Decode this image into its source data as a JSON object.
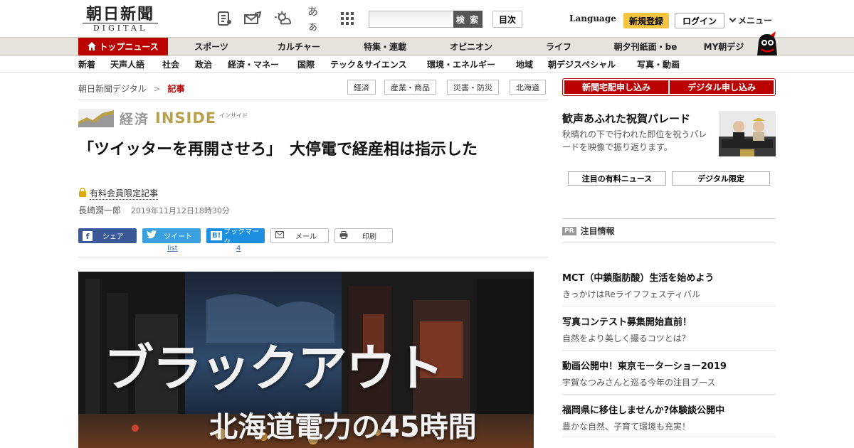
{
  "header": {
    "logo_ja": "朝日新聞",
    "logo_en": "DIGITAL",
    "icons": [
      "paper-icon",
      "mail-icon",
      "weather-icon",
      "font-size-icon",
      "apps-grid-icon"
    ],
    "font_icon_text": "あぁ",
    "search_placeholder": "",
    "search_label": "検 索",
    "toc_label": "目次",
    "language_label": "Language",
    "register_label": "新規登録",
    "login_label": "ログイン",
    "menu_label": "メニュー"
  },
  "nav_primary": [
    "トップニュース",
    "スポーツ",
    "カルチャー",
    "特集・連載",
    "オピニオン",
    "ライフ",
    "朝夕刊紙面・be",
    "MY朝デジ"
  ],
  "nav_secondary": [
    "新着",
    "天声人語",
    "社会",
    "政治",
    "経済・マネー",
    "国際",
    "テック＆サイエンス",
    "環境・エネルギー",
    "地域",
    "朝デジスペシャル",
    "写真・動画"
  ],
  "breadcrumb": {
    "root": "朝日新聞デジタル",
    "sep": ">",
    "current": "記事"
  },
  "tags": [
    "経済",
    "産業・商品",
    "災害・防災",
    "北海道"
  ],
  "series": {
    "word1": "経済",
    "word2": "INSIDE",
    "ruby": "インサイド"
  },
  "article": {
    "headline": "「ツイッターを再開させろ」　大停電で経産相は指示した",
    "members_label": "有料会員限定記事",
    "author": "長崎潤一郎",
    "date": "2019年11月12日18時30分"
  },
  "share": {
    "facebook": "シェア",
    "twitter": "ツイート",
    "twitter_count": "list",
    "hatena": "ブックマーク",
    "hatena_count": "4",
    "mail": "メール",
    "print": "印刷"
  },
  "hero": {
    "title": "ブラックアウト",
    "subtitle": "北海道電力の45時間"
  },
  "sidebar": {
    "cta_left": "新聞宅配申し込み",
    "cta_right": "デジタル申し込み",
    "feature_title": "歓声あふれた祝賀パレード",
    "feature_desc": "秋晴れの下で行われた即位を祝うパレードを映像で振り返ります。",
    "btn_paid": "注目の有料ニュース",
    "btn_digital": "デジタル限定",
    "pr_badge": "PR",
    "pr_label": "注目情報",
    "ads": [
      {
        "title": "MCT（中鎖脂肪酸）生活を始めよう",
        "sub": "きっかけはReライフフェスティバル"
      },
      {
        "title": "写真コンテスト募集開始直前！",
        "sub": "自然をより美しく撮るコツとは？"
      },
      {
        "title": "動画公開中！東京モーターショー2019",
        "sub": "宇賀なつみさんと巡る今年の注目ブース"
      },
      {
        "title": "福岡県に移住しませんか?体験談公開中",
        "sub": "豊かな自然、子育て環境も充実！"
      }
    ]
  },
  "colors": {
    "brand_red": "#bb0000",
    "gold": "#b9a04a",
    "register_yellow": "#f5c542"
  }
}
